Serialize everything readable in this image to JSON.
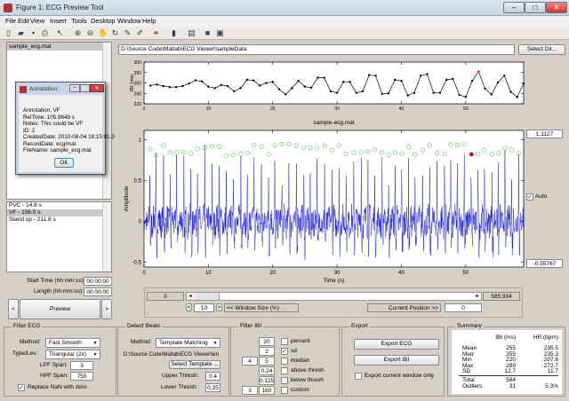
{
  "window": {
    "title": "Figure 1: ECG Preview Tool",
    "min": "–",
    "max": "□",
    "close": "✕"
  },
  "menu": [
    "File",
    "Edit",
    "View",
    "Insert",
    "Tools",
    "Desktop",
    "Window",
    "Help"
  ],
  "toolbar_icons": [
    "new-file-icon",
    "open-folder-icon",
    "save-icon",
    "print-icon",
    "pointer-icon",
    "zoom-in-icon",
    "zoom-out-icon",
    "pan-icon",
    "rotate-icon",
    "data-cursor-icon",
    "brush-icon",
    "link-icon",
    "colorbar-icon",
    "legend-icon",
    "hide-plot-tools-icon",
    "show-plot-tools-icon"
  ],
  "files": {
    "items": [
      "sample_ecg.mat"
    ],
    "selected": 0
  },
  "path": {
    "value": "D:\\Source Code\\Matlab\\ECG Viewer\\sampleData",
    "select_dir": "Select Dir..."
  },
  "annotation_dialog": {
    "title": "Annotation:",
    "lines": [
      "Annotation:  VF",
      "RelTime:  105.9649 s",
      "Notes:  This could be VF",
      "ID:  2",
      "CreatedDate:  2010-08-04 18:15:01.0",
      "RecordDate:  ecg/mat",
      "FileName:  sample_ecg.mat"
    ],
    "ok": "OK"
  },
  "annotations": {
    "items": [
      "PVC - 14.8 s",
      "VF - 106.0 s",
      "Stand up - 211.8 s"
    ],
    "selected": 1
  },
  "time": {
    "start_label": "Start Time (hh:mm:ss):",
    "start_value": "00:00:00",
    "length_label": "Length (hh:mm:ss):",
    "length_value": "00:00:00"
  },
  "preview": {
    "prev": "<",
    "label": "Preview",
    "next": ">"
  },
  "chart_data": [
    {
      "type": "line",
      "ylabel": "IBI (ms)",
      "ylim": [
        220,
        300
      ],
      "yticks": [
        220,
        240,
        260,
        280,
        300
      ],
      "xlim": [
        0,
        59
      ],
      "xticks": [
        0,
        10,
        20,
        30,
        40,
        50
      ],
      "x": [
        1,
        2,
        3,
        4,
        5,
        6,
        7,
        8,
        9,
        10,
        11,
        12,
        13,
        14,
        15,
        16,
        17,
        18,
        19,
        20,
        21,
        22,
        23,
        24,
        25,
        26,
        27,
        28,
        29,
        30,
        31,
        32,
        33,
        34,
        35,
        36,
        37,
        38,
        39,
        40,
        41,
        42,
        43,
        44,
        45,
        46,
        47,
        48,
        49,
        50,
        51,
        52,
        53,
        54,
        55,
        56,
        57,
        58,
        59
      ],
      "values": [
        255,
        257,
        254,
        252,
        252,
        254,
        259,
        265,
        263,
        253,
        250,
        256,
        254,
        244,
        250,
        266,
        265,
        255,
        260,
        262,
        248,
        238,
        250,
        264,
        253,
        251,
        270,
        270,
        244,
        241,
        262,
        262,
        241,
        244,
        275,
        274,
        239,
        240,
        266,
        264,
        236,
        241,
        274,
        277,
        241,
        241,
        266,
        268,
        237,
        233,
        264,
        282,
        249,
        238,
        261,
        274,
        243,
        233,
        259
      ],
      "highlight_index": 51,
      "line_color": "#000000",
      "highlight_color": "#ff0000"
    },
    {
      "type": "line",
      "title": "sample-ecg.mat",
      "xlabel": "Time (s)",
      "ylabel": "Amplitude",
      "ylim": [
        -0.55767,
        1.1127
      ],
      "yticks": [
        -0.5,
        0,
        0.5,
        1
      ],
      "xlim": [
        0,
        59
      ],
      "xticks": [
        0,
        10,
        20,
        30,
        40,
        50
      ],
      "signal_color": "#0000cc",
      "peak_marker_color": "#66cc66",
      "selected_peak_color": "#dd0000",
      "selected_peak_time": 50.9,
      "selected_peak_amplitude": 0.82
    }
  ],
  "axes_limits": {
    "ymax": "1.1127",
    "ymin": "-0.55767",
    "auto_label": "Auto",
    "auto_checked": true
  },
  "scroll": {
    "start": "0",
    "end": "585.934",
    "window_dec": "<",
    "window_size": "10",
    "window_inc": ">",
    "window_label": "<< Window Size (%)",
    "position_label": "Current Position >>",
    "position": "0",
    "slider_fraction": 0.0
  },
  "filter_ecg": {
    "title": "Filter ECG",
    "method_label": "Method:",
    "method": "Fast Smooth",
    "type_label": "Type/Lev:",
    "type": "Triangular (2x)",
    "lpf_label": "LPF Span:",
    "lpf": "3",
    "hpf_label": "HPF Span:",
    "hpf": "750",
    "replace_nan": "Replace NaN with zero.",
    "replace_nan_checked": true
  },
  "detect_beats": {
    "title": "Detect Beats",
    "method_label": "Method:",
    "method": "Template Matching",
    "template_path": "D:\\Source Code\\Matlab\\ECG Viewer\\ten",
    "select_template": "Select Template ...",
    "upper_label": "Upper Thresh:",
    "upper": "0.4",
    "lower_label": "Lower Thresh:",
    "lower": "0.35"
  },
  "filter_ibi": {
    "title": "Filter IBI",
    "rows": [
      {
        "a": "",
        "b": "20",
        "label": "percent",
        "checked": false
      },
      {
        "a": "",
        "b": "2",
        "label": "sd",
        "checked": true
      },
      {
        "a": "4",
        "b": "5",
        "label": "median",
        "checked": false
      },
      {
        "a": "",
        "b": "0.24",
        "label": "above thresh",
        "checked": false
      },
      {
        "a": "",
        "b": "0.125",
        "label": "below thresh",
        "checked": false
      },
      {
        "a": "3",
        "b": "160",
        "label": "custom",
        "checked": false
      }
    ]
  },
  "export": {
    "title": "Export",
    "ecg": "Export ECG",
    "ibi": "Export IBI",
    "window_only": "Export current window only",
    "window_only_checked": false
  },
  "summary": {
    "title": "Summary",
    "headers": [
      "",
      "IBI (ms)",
      "HR (bpm)"
    ],
    "rows": [
      [
        "Mean",
        "255",
        "235.5"
      ],
      [
        "Med",
        "255",
        "235.3"
      ],
      [
        "Min",
        "220",
        "207.6"
      ],
      [
        "Max",
        "289",
        "272.7"
      ],
      [
        "SD",
        "12.7",
        "11.7"
      ]
    ],
    "totals": [
      [
        "Total",
        "584",
        ""
      ],
      [
        "Outliers",
        "31",
        "5.3%"
      ]
    ]
  }
}
